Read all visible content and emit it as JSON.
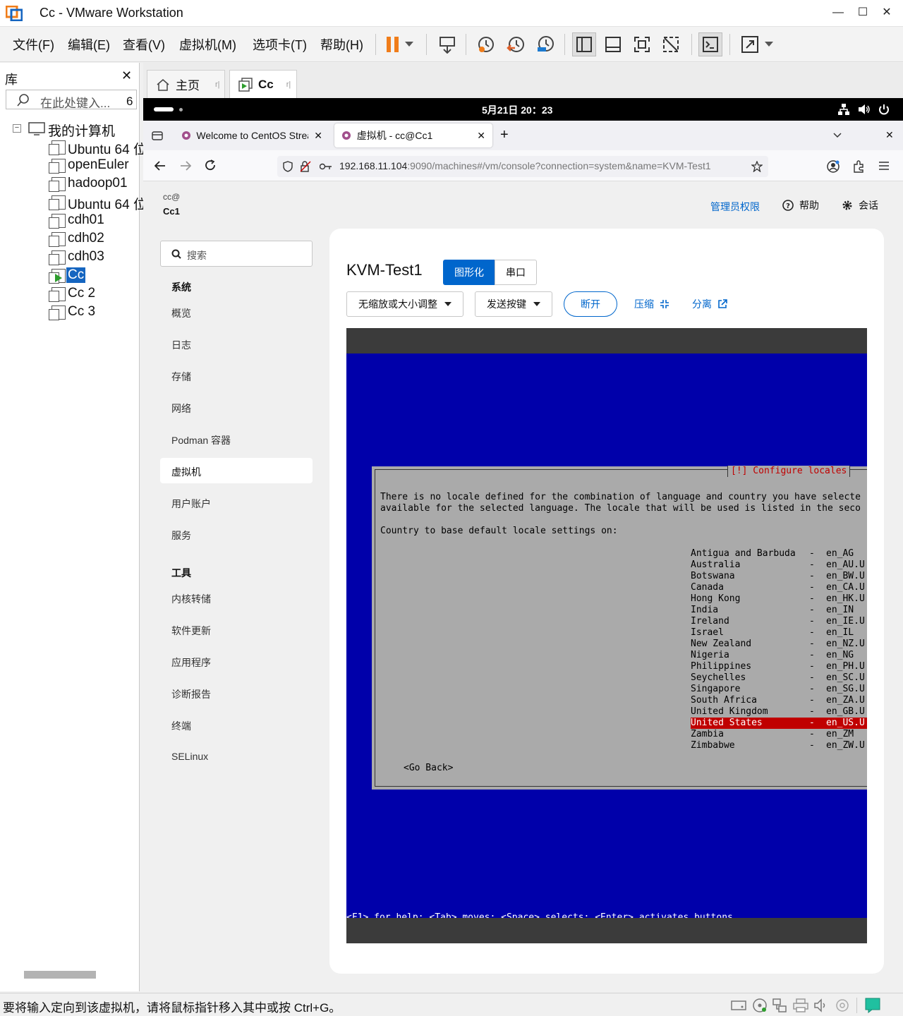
{
  "window": {
    "title": "Cc - VMware Workstation"
  },
  "menubar": {
    "items": [
      "文件(F)",
      "编辑(E)",
      "查看(V)",
      "虚拟机(M)",
      "选项卡(T)",
      "帮助(H)"
    ]
  },
  "library": {
    "title": "库",
    "search_placeholder": "在此处键入...",
    "search_count": "6",
    "root": "我的计算机",
    "vms": [
      "Ubuntu 64 位",
      "openEuler",
      "hadoop01",
      "Ubuntu 64 位",
      "cdh01",
      "cdh02",
      "cdh03",
      "Cc",
      "Cc 2",
      "Cc 3"
    ]
  },
  "tabs": {
    "home": "主页",
    "current": "Cc"
  },
  "guest_topbar": {
    "datetime": "5月21日 20：23"
  },
  "firefox": {
    "tabs": [
      "Welcome to CentOS Stream",
      "虚拟机 - cc@Cc1"
    ],
    "url_host": "192.168.11.104",
    "url_rest": ":9090/machines#/vm/console?connection=system&name=KVM-Test1"
  },
  "cockpit": {
    "user": "cc@",
    "host": "Cc1",
    "admin": "管理员权限",
    "help": "帮助",
    "session": "会话",
    "search_placeholder": "搜索",
    "system_section": "系统",
    "nav_system": [
      "概览",
      "日志",
      "存储",
      "网络",
      "Podman 容器",
      "虚拟机",
      "用户账户",
      "服务"
    ],
    "tools_section": "工具",
    "nav_tools": [
      "内核转储",
      "软件更新",
      "应用程序",
      "诊断报告",
      "终端",
      "SELinux"
    ],
    "active_item": "虚拟机"
  },
  "vm": {
    "name": "KVM-Test1",
    "tab_graphical": "图形化",
    "tab_serial": "串口",
    "scale_select": "无缩放或大小调整",
    "send_key": "发送按键",
    "disconnect": "断开",
    "compress": "压缩",
    "detach": "分离"
  },
  "installer": {
    "dialog_title": "[!] Configure locales",
    "intro_line1": "There is no locale defined for the combination of language and country you have selecte",
    "intro_line2": "available for the selected language. The locale that will be used is listed in the seco",
    "prompt": "Country to base default locale settings on:",
    "countries": [
      {
        "name": "Antigua and Barbuda",
        "locale": "en_AG"
      },
      {
        "name": "Australia",
        "locale": "en_AU.U"
      },
      {
        "name": "Botswana",
        "locale": "en_BW.U"
      },
      {
        "name": "Canada",
        "locale": "en_CA.U"
      },
      {
        "name": "Hong Kong",
        "locale": "en_HK.U"
      },
      {
        "name": "India",
        "locale": "en_IN"
      },
      {
        "name": "Ireland",
        "locale": "en_IE.U"
      },
      {
        "name": "Israel",
        "locale": "en_IL"
      },
      {
        "name": "New Zealand",
        "locale": "en_NZ.U"
      },
      {
        "name": "Nigeria",
        "locale": "en_NG"
      },
      {
        "name": "Philippines",
        "locale": "en_PH.U"
      },
      {
        "name": "Seychelles",
        "locale": "en_SC.U"
      },
      {
        "name": "Singapore",
        "locale": "en_SG.U"
      },
      {
        "name": "South Africa",
        "locale": "en_ZA.U"
      },
      {
        "name": "United Kingdom",
        "locale": "en_GB.U"
      },
      {
        "name": "United States",
        "locale": "en_US.U"
      },
      {
        "name": "Zambia",
        "locale": "en_ZM"
      },
      {
        "name": "Zimbabwe",
        "locale": "en_ZW.U"
      }
    ],
    "selected": "United States",
    "go_back": "<Go Back>",
    "help_line": "<F1> for help; <Tab> moves; <Space> selects; <Enter> activates buttons"
  },
  "statusbar": {
    "message": "要将输入定向到该虚拟机，请将鼠标指针移入其中或按 Ctrl+G。"
  },
  "colors": {
    "cockpit_blue": "#0066cc",
    "installer_blue": "#0000aa",
    "selection_red": "#c00000",
    "vmware_orange": "#f07d1a"
  }
}
